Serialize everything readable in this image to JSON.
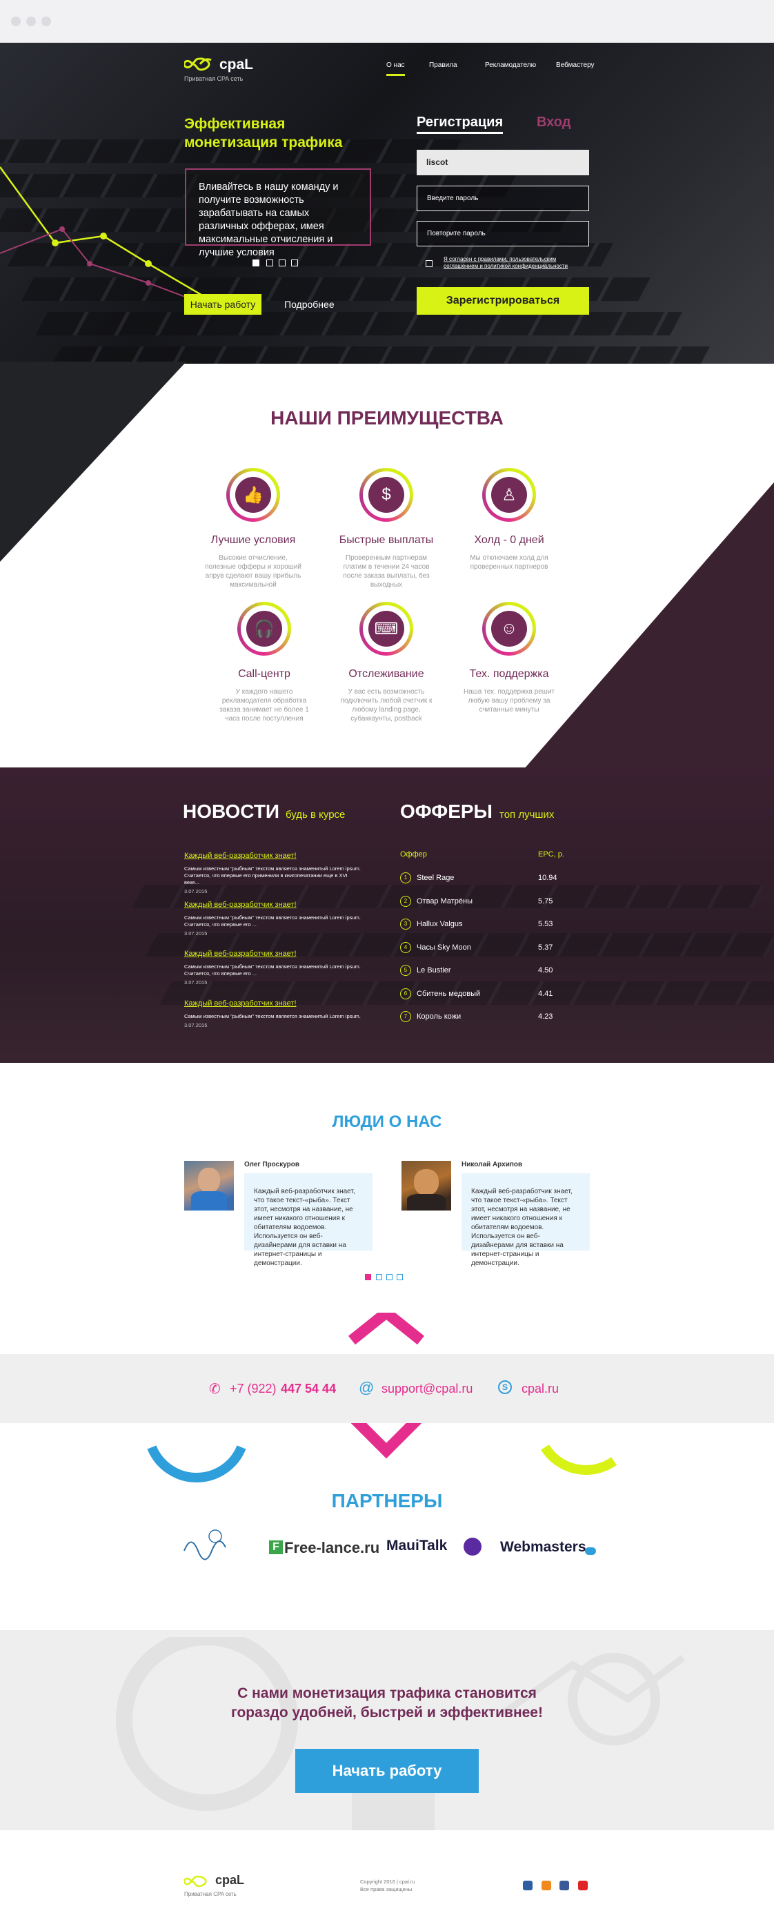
{
  "header": {
    "brand": "cpaL",
    "brand_sub": "Приватная CPA сеть",
    "nav": [
      {
        "label": "О нас"
      },
      {
        "label": "Правила"
      },
      {
        "label": "Рекламодателю"
      },
      {
        "label": "Вебмастеру"
      }
    ]
  },
  "hero": {
    "title_line1": "Эффективная",
    "title_line2": "монетизация трафика",
    "text": "Вливайтесь в нашу команду и получите возможность зарабатывать на самых различных офферах, имея максимальные отчисления и лучшие условия",
    "start_button": "Начать работу",
    "more_link": "Подробнее"
  },
  "form": {
    "tab_register": "Регистрация",
    "tab_login": "Вход",
    "login_value": "liscot",
    "password_placeholder": "Введите пароль",
    "repeat_placeholder": "Повторите пароль",
    "agree_text": "Я согласен с правилами, пользовательским соглашением и политикой конфиденциальности",
    "submit": "Зарегистрироваться"
  },
  "advantages": {
    "title": "НАШИ ПРЕИМУЩЕСТВА",
    "items": [
      {
        "name": "Лучшие условия",
        "desc": "Высокие отчисление, полезные офферы и хороший апрув сделают вашу прибыль максимальной",
        "icon": "thumbs-up-icon"
      },
      {
        "name": "Быстрые выплаты",
        "desc": "Проверенным партнерам платим в течении 24 часов после заказа выплаты, без выходных",
        "icon": "dollar-coin-icon"
      },
      {
        "name": "Холд - 0 дней",
        "desc": "Мы отключаем холд для проверенных партнеров",
        "icon": "user-icon"
      },
      {
        "name": "Call-центр",
        "desc": "У каждого нашего рекламодателя обработка заказа занимает не более 1 часа после поступления",
        "icon": "headphones-icon"
      },
      {
        "name": "Отслеживание",
        "desc": "У вас есть возможность подключить любой счетчик к любому landing page, субаккаунты, postback",
        "icon": "keyboard-icon"
      },
      {
        "name": "Тех. поддержка",
        "desc": "Наша тех. поддержка решит любую вашу проблему за считанные минуты",
        "icon": "support-woman-icon"
      }
    ]
  },
  "news": {
    "title": "НОВОСТИ",
    "subtitle": "будь в курсе",
    "items": [
      {
        "link": "Каждый веб-разработчик знает!",
        "text": "Самым известным \"рыбным\" текстом является знаменитый Lorem ipsum. Считается, что впервые его применили в книгопечатании еще в XVI веке...",
        "date": "3.07.2015"
      },
      {
        "link": "Каждый веб-разработчик знает!",
        "text": "Самым известным \"рыбным\" текстом является знаменитый Lorem ipsum. Считается, что впервые его ...",
        "date": "3.07.2015"
      },
      {
        "link": "Каждый веб-разработчик знает!",
        "text": "Самым известным \"рыбным\" текстом является знаменитый Lorem ipsum. Считается, что впервые его ...",
        "date": "3.07.2015"
      },
      {
        "link": "Каждый веб-разработчик знает!",
        "text": "Самым известным \"рыбным\" текстом является знаменитый Lorem ipsum.",
        "date": "3.07.2015"
      }
    ]
  },
  "offers": {
    "title": "ОФФЕРЫ",
    "subtitle": "топ лучших",
    "col_offer": "Оффер",
    "col_epc": "EPC, р.",
    "rows": [
      {
        "n": "1",
        "name": "Steel Rage",
        "epc": "10.94"
      },
      {
        "n": "2",
        "name": "Отвар Матрёны",
        "epc": "5.75"
      },
      {
        "n": "3",
        "name": "Hallux Valgus",
        "epc": "5.53"
      },
      {
        "n": "4",
        "name": "Часы Sky Moon",
        "epc": "5.37"
      },
      {
        "n": "5",
        "name": "Le Bustier",
        "epc": "4.50"
      },
      {
        "n": "6",
        "name": "Сбитень медовый",
        "epc": "4.41"
      },
      {
        "n": "7",
        "name": "Король кожи",
        "epc": "4.23"
      }
    ]
  },
  "reviews": {
    "title": "ЛЮДИ О НАС",
    "items": [
      {
        "name": "Олег Проскуров",
        "text": "Каждый веб-разработчик знает, что такое текст-«рыба». Текст этот, несмотря на название, не имеет никакого отношения к обитателям водоемов. Используется он веб-дизайнерами для вставки на интернет-страницы и демонстрации."
      },
      {
        "name": "Николай Архипов",
        "text": "Каждый веб-разработчик знает, что такое текст-«рыба». Текст этот, несмотря на название, не имеет никакого отношения к обитателям водоемов. Используется он веб-дизайнерами для вставки на интернет-страницы и демонстрации."
      }
    ]
  },
  "contacts": {
    "phone_prefix": "+7 (922)",
    "phone_number": "447 54 44",
    "email": "support@cpal.ru",
    "skype": "cpal.ru"
  },
  "partners": {
    "title": "ПАРТНЕРЫ",
    "items": [
      "Free-lance.ru",
      "MauiTalk",
      "Webmasters"
    ]
  },
  "cta": {
    "line1": "С нами монетизация трафика становится",
    "line2": "гораздо удобней, быстрей и эффективнее!",
    "button": "Начать работу"
  },
  "footer": {
    "brand": "cpaL",
    "brand_sub": "Приватная CPA сеть",
    "copyright1": "Copyright 2016 | cpal.ru",
    "copyright2": "Все права защищены"
  },
  "colors": {
    "lime": "#d9f215",
    "plum": "#722b57",
    "blue": "#2f9fdb",
    "pink": "#e52d8d"
  }
}
